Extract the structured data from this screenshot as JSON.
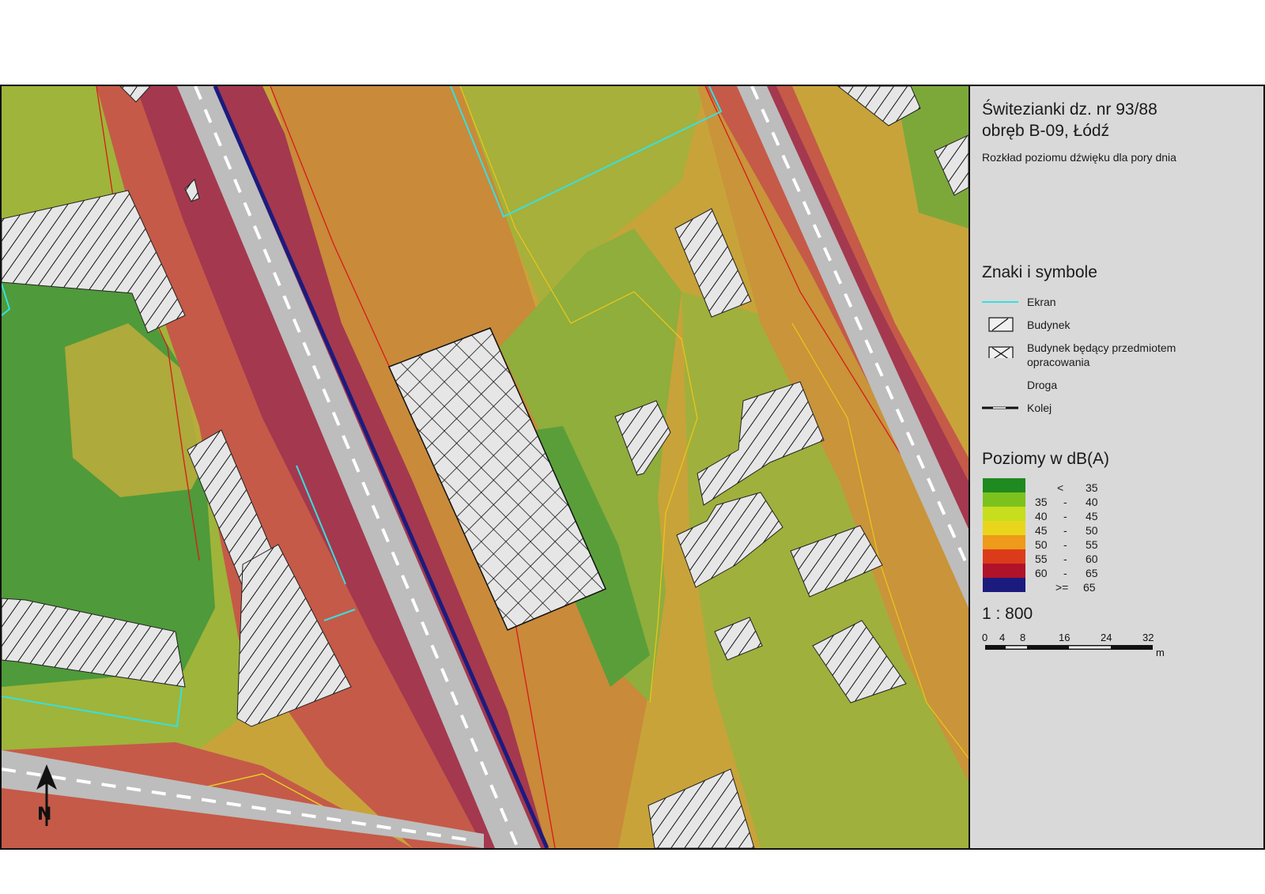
{
  "map": {
    "north_label": "N",
    "colors": {
      "lt35": "#1f8a1f",
      "c35_40": "#7cc21e",
      "c40_45": "#c6de1d",
      "c45_50": "#e9d61c",
      "c50_55": "#ee9a1a",
      "c55_60": "#dc3b1a",
      "c60_65": "#b0122a",
      "ge65": "#1b1b7e",
      "screen": "#36e0e0",
      "road": "#bdbdbd"
    }
  },
  "panel": {
    "title_line1": "Świtezianki dz. nr 93/88",
    "title_line2": "obręb B-09, Łódź",
    "subtitle": "Rozkład poziomu dźwięku dla pory dnia",
    "legend_heading": "Znaki i symbole",
    "legend_items": [
      {
        "label": "Ekran",
        "icon": "screen-line-icon"
      },
      {
        "label": "Budynek",
        "icon": "building-hatch-icon"
      },
      {
        "label": "Budynek będący przedmiotem",
        "label2": "opracowania",
        "icon": "subject-building-icon"
      },
      {
        "label": "Droga",
        "icon": "road-icon"
      },
      {
        "label": "Kolej",
        "icon": "railway-icon"
      }
    ],
    "levels_heading": "Poziomy w dB(A)",
    "levels": [
      {
        "from": "<",
        "to": "35",
        "color": "#1f8a1f"
      },
      {
        "from": "35",
        "to": "40",
        "color": "#7cc21e"
      },
      {
        "from": "40",
        "to": "45",
        "color": "#c6de1d"
      },
      {
        "from": "45",
        "to": "50",
        "color": "#e9d61c"
      },
      {
        "from": "50",
        "to": "55",
        "color": "#ee9a1a"
      },
      {
        "from": "55",
        "to": "60",
        "color": "#dc3b1a"
      },
      {
        "from": "60",
        "to": "65",
        "color": "#b0122a"
      },
      {
        "from": ">=",
        "to": "65",
        "color": "#1b1b7e"
      }
    ],
    "scale_ratio": "1 : 800",
    "scale_ticks": [
      "0",
      "4",
      "8",
      "16",
      "24",
      "32"
    ],
    "scale_unit": "m"
  }
}
